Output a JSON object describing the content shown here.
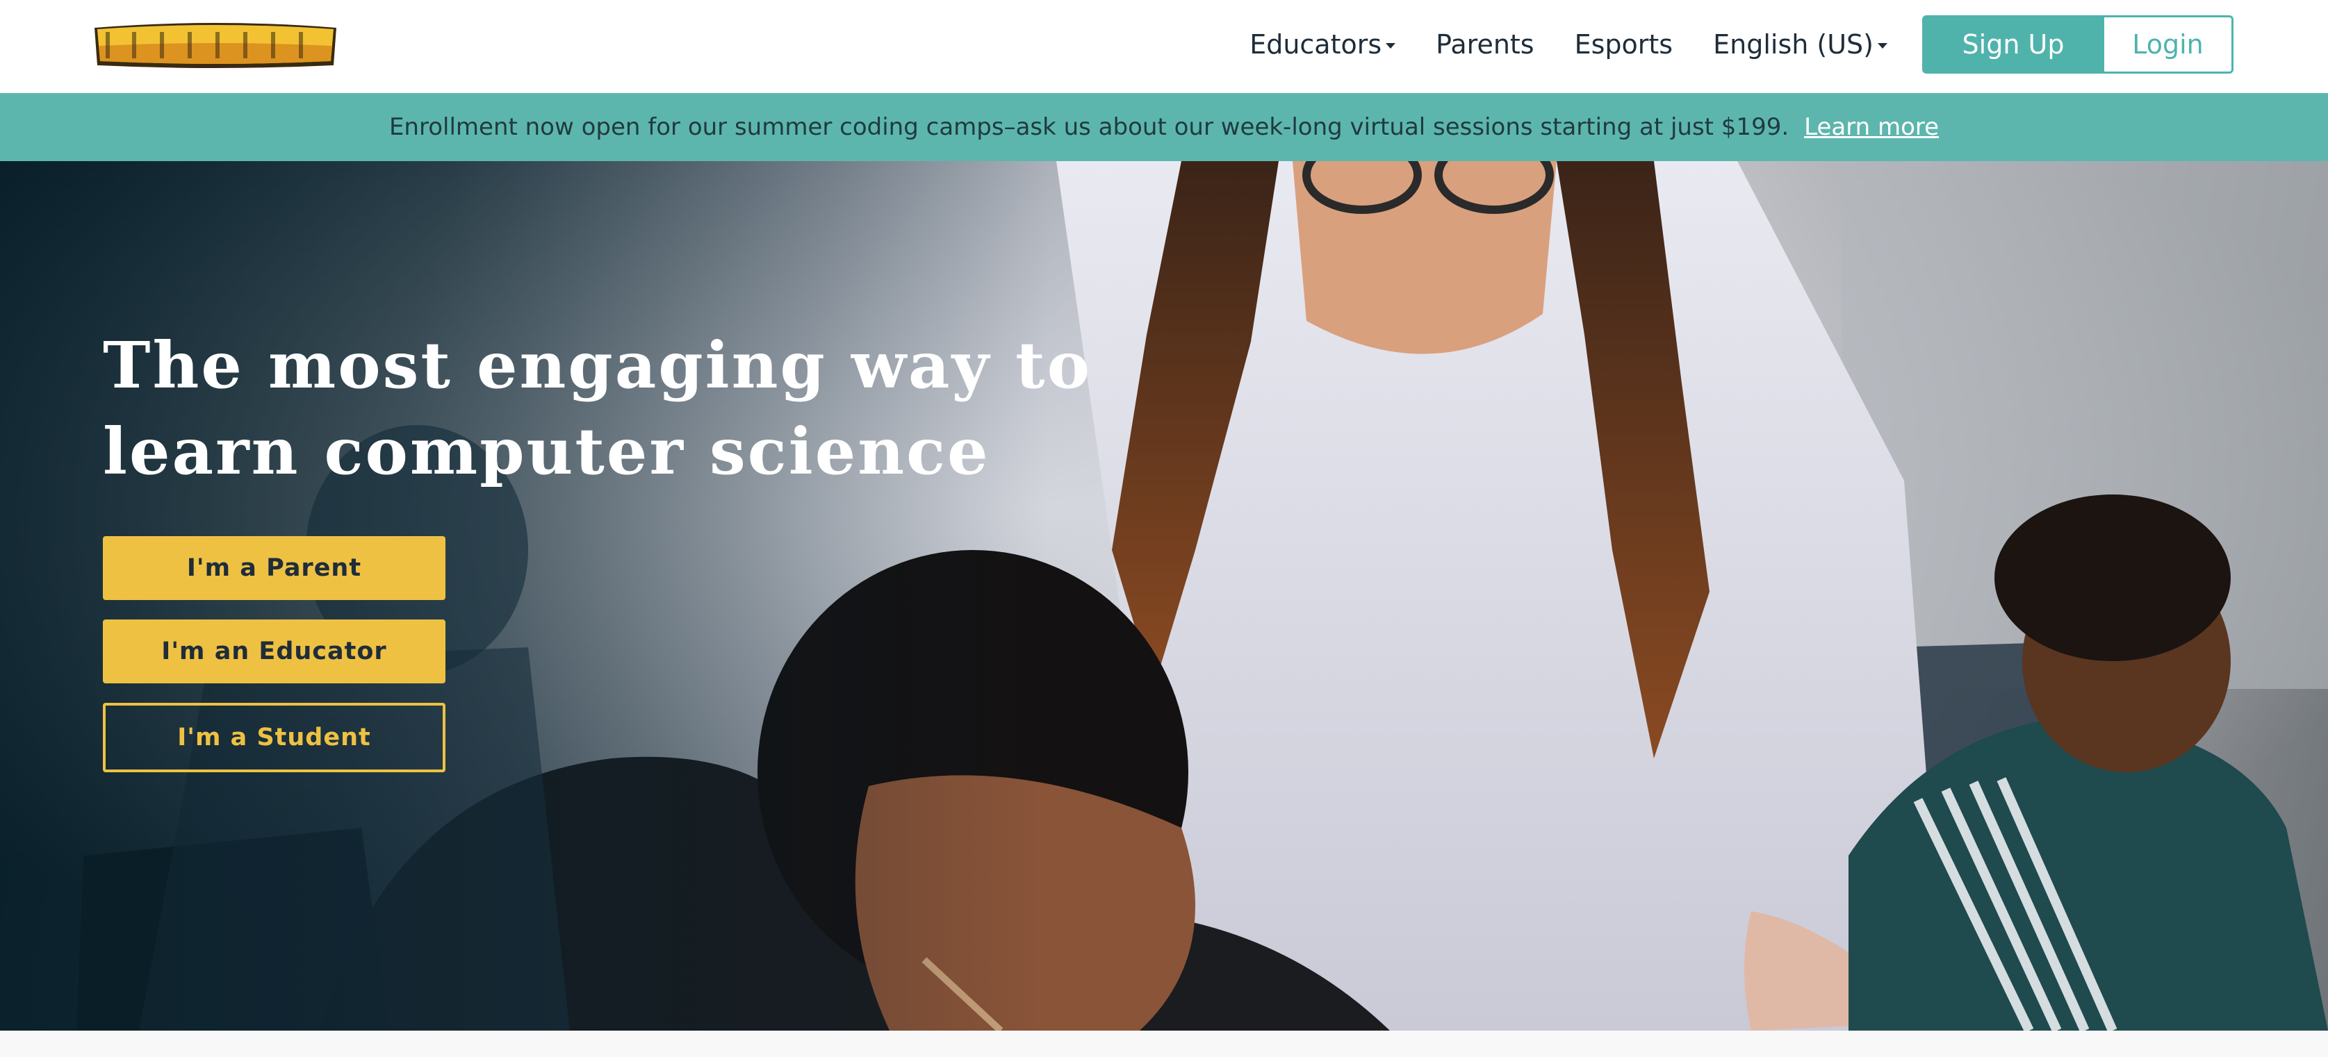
{
  "nav": {
    "logo_alt": "CodeCombat",
    "items": [
      {
        "label": "Educators",
        "dropdown": true
      },
      {
        "label": "Parents",
        "dropdown": false
      },
      {
        "label": "Esports",
        "dropdown": false
      },
      {
        "label": "English (US)",
        "dropdown": true
      }
    ],
    "signup_label": "Sign Up",
    "login_label": "Login"
  },
  "banner": {
    "text": "Enrollment now open for our summer coding camps–ask us about our week-long virtual sessions starting at just $199.",
    "link_label": "Learn more"
  },
  "hero": {
    "title": "The most engaging way to learn computer science",
    "buttons": {
      "parent": "I'm a Parent",
      "educator": "I'm an Educator",
      "student": "I'm a Student"
    }
  },
  "colors": {
    "teal": "#4fb3ac",
    "banner": "#5db6ad",
    "gold": "#efc142",
    "text_dark": "#1f2d3a"
  }
}
